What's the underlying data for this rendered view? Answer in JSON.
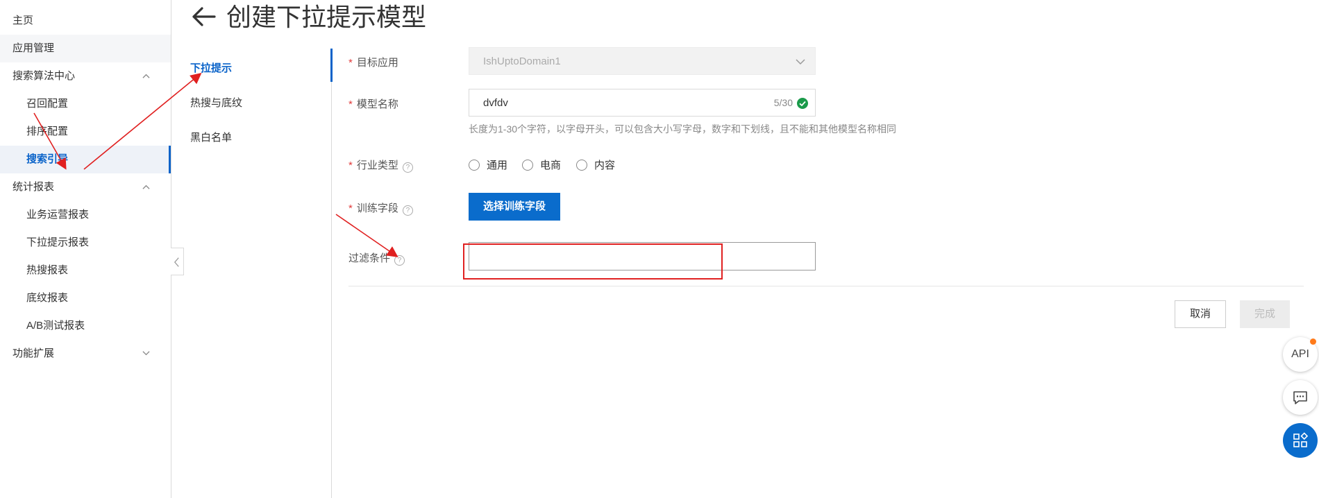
{
  "sidebar": {
    "items": [
      {
        "label": "主页"
      },
      {
        "label": "应用管理"
      },
      {
        "label": "搜索算法中心"
      },
      {
        "label": "召回配置"
      },
      {
        "label": "排序配置"
      },
      {
        "label": "搜索引导"
      },
      {
        "label": "统计报表"
      },
      {
        "label": "业务运营报表"
      },
      {
        "label": "下拉提示报表"
      },
      {
        "label": "热搜报表"
      },
      {
        "label": "底纹报表"
      },
      {
        "label": "A/B测试报表"
      },
      {
        "label": "功能扩展"
      }
    ]
  },
  "header": {
    "title": "创建下拉提示模型"
  },
  "secondary_nav": {
    "items": [
      {
        "label": "下拉提示"
      },
      {
        "label": "热搜与底纹"
      },
      {
        "label": "黑白名单"
      }
    ]
  },
  "form": {
    "required_mark": "*",
    "target_app": {
      "label": "目标应用",
      "value": "IshUptoDomain1"
    },
    "model_name": {
      "label": "模型名称",
      "value": "dvfdv",
      "counter": "5/30",
      "hint": "长度为1-30个字符，以字母开头，可以包含大小写字母，数字和下划线，且不能和其他模型名称相同"
    },
    "industry": {
      "label": "行业类型",
      "options": [
        {
          "label": "通用"
        },
        {
          "label": "电商"
        },
        {
          "label": "内容"
        }
      ]
    },
    "training_field": {
      "label": "训练字段",
      "button": "选择训练字段"
    },
    "filter": {
      "label": "过滤条件",
      "value": ""
    },
    "help_glyph": "?",
    "cancel": "取消",
    "done": "完成"
  },
  "floating": {
    "api": "API"
  },
  "colors": {
    "primary": "#0a6ccc",
    "active_text": "#0a63c9",
    "required": "#e23c3c",
    "annotation": "#e02020",
    "success": "#1a9a4a",
    "badge": "#ff7a1a"
  }
}
